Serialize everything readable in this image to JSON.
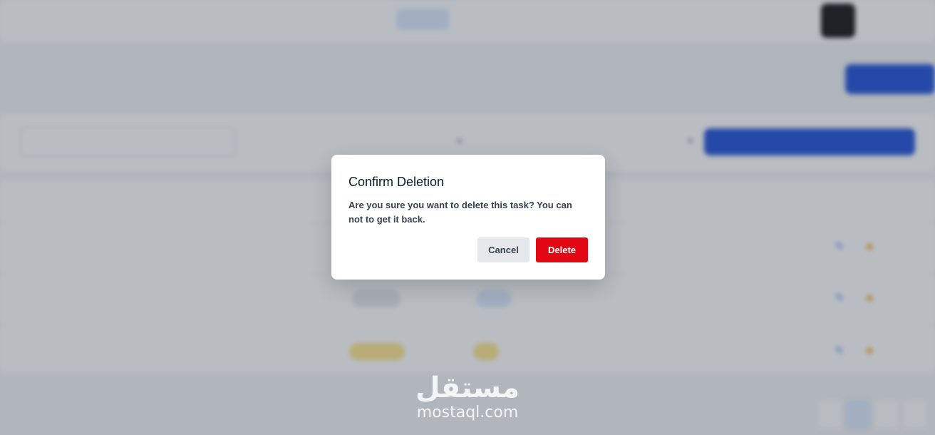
{
  "dialog": {
    "title": "Confirm Deletion",
    "message": "Are you sure you want to delete this task? You can not to get it back.",
    "cancel_label": "Cancel",
    "delete_label": "Delete"
  },
  "watermark": {
    "arabic": "مستقل",
    "latin": "mostaql.com"
  },
  "colors": {
    "delete_button": "#e30613",
    "primary_blue": "#1d4ed8",
    "overlay": "rgba(55,65,81,0.35)"
  }
}
